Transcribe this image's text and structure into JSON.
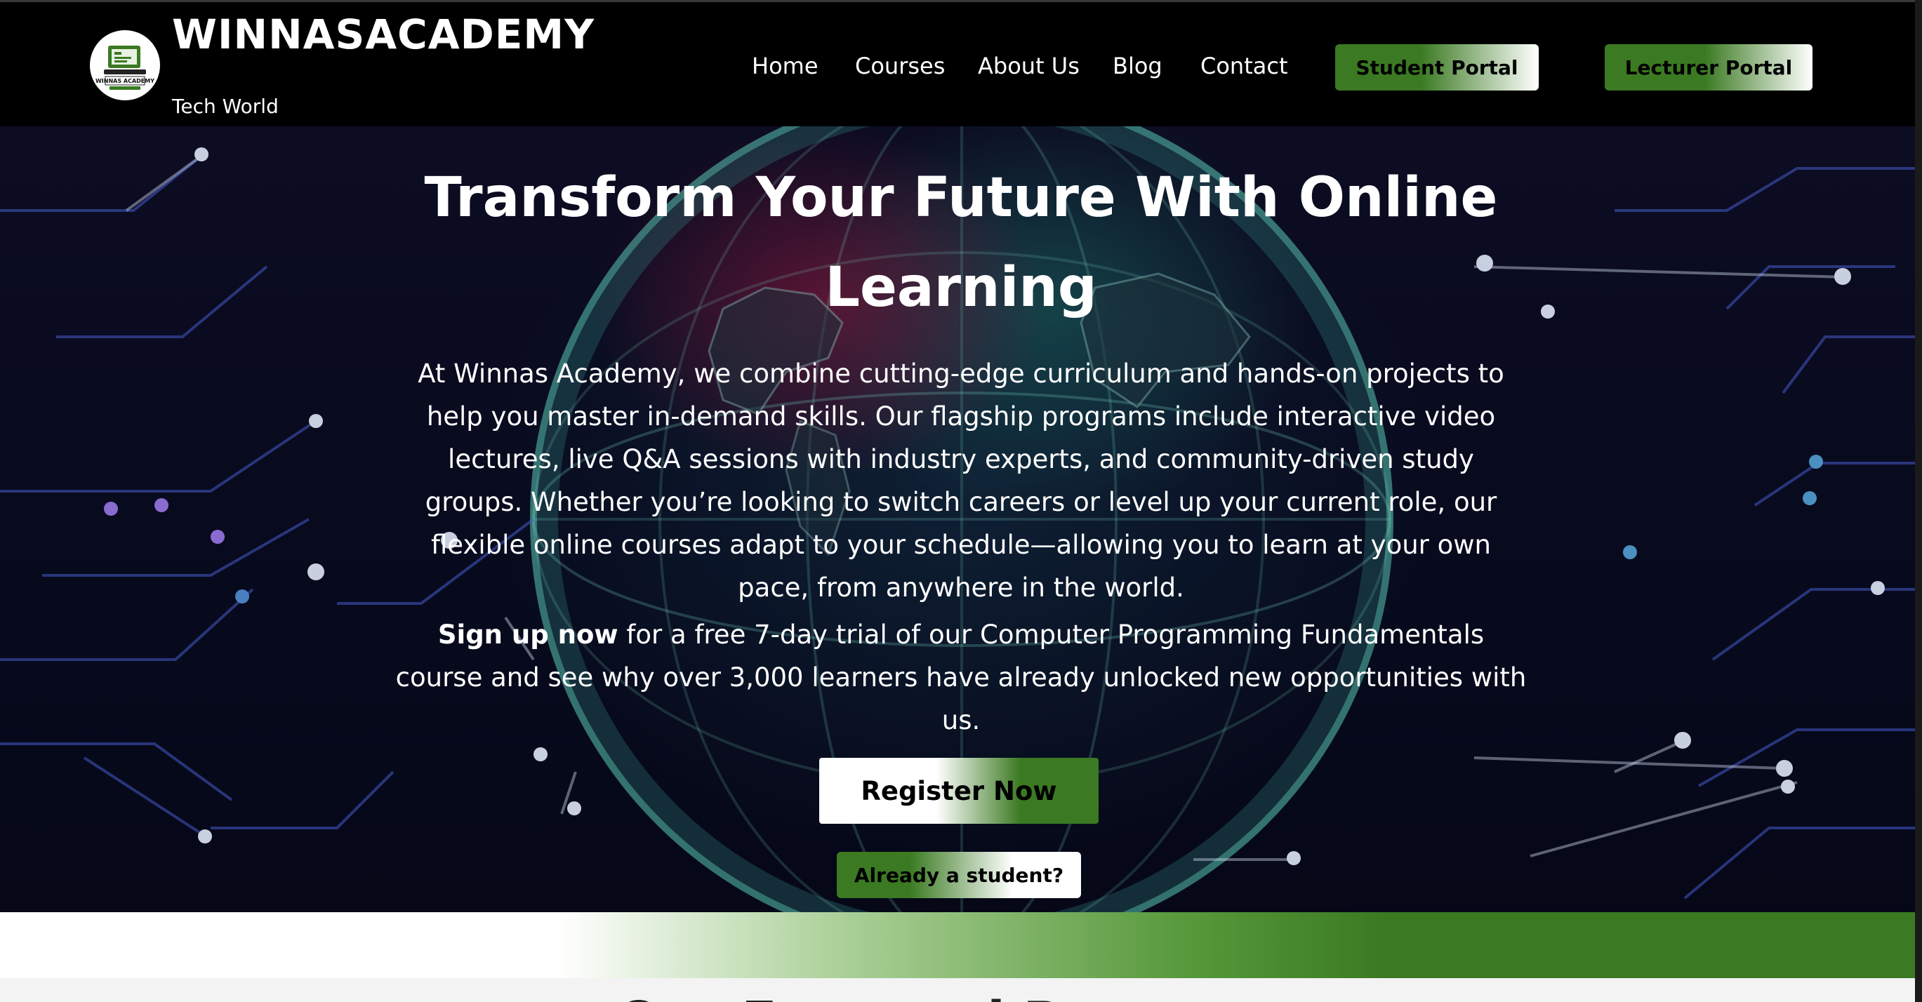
{
  "header": {
    "brand_name": "WINNASACADEMY",
    "tagline": "Tech World",
    "logo_text": "WINNAS ACADEMY",
    "nav": [
      {
        "label": "Home"
      },
      {
        "label": "Courses"
      },
      {
        "label": "About Us"
      },
      {
        "label": "Blog"
      },
      {
        "label": "Contact"
      }
    ],
    "student_portal_label": "Student Portal",
    "lecturer_portal_label": "Lecturer Portal"
  },
  "hero": {
    "title_line1": "Transform Your Future With Online",
    "title_line2": "Learning",
    "description": "At Winnas Academy, we combine cutting-edge curriculum and hands-on projects to help you master in-demand skills. Our flagship programs include interactive video lectures, live Q&A sessions with industry experts, and community-driven study groups. Whether you’re looking to switch careers or level up your current role, our flexible online courses adapt to your schedule—allowing you to learn at your own pace, from anywhere in the world.",
    "cta_bold": "Sign up now",
    "cta_rest": " for a free 7-day trial of our Computer Programming Fundamentals course and see why over 3,000 learners have already unlocked new opportunities with us.",
    "register_label": "Register Now",
    "already_student_label": "Already a student?"
  },
  "next_section": {
    "heading": "Our Featured Programs"
  },
  "colors": {
    "header_bg": "#000000",
    "accent_green": "#3b7a22",
    "hero_bg": "#070a1d",
    "text_light": "#ffffff"
  },
  "icons": {
    "logo": "academy-logo-icon"
  }
}
